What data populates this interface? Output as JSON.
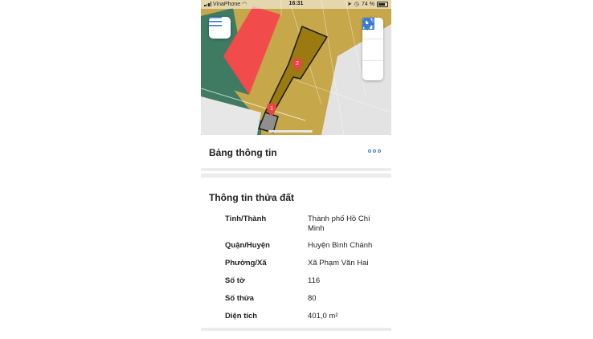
{
  "status_bar": {
    "carrier": "VinaPhone",
    "time": "16:31",
    "battery": "74 %"
  },
  "map": {
    "parcel_markers": [
      "1",
      "2"
    ],
    "colors": {
      "base_land": "#c6a74a",
      "highlight_red": "#f24b4b",
      "dark_green": "#3f7a63",
      "selected_parcel": "#9c7a12",
      "marker": "#e84545"
    },
    "buttons": {
      "menu_icon": "hamburger-menu-icon",
      "layers_icon": "grid-layers-icon",
      "location_icon": "location-pin-icon",
      "filter_icon": "sliders-icon"
    }
  },
  "panel": {
    "title": "Bảng thông tin",
    "more_icon": "more-dots-icon",
    "section_title": "Thông tin thửa đất",
    "rows": [
      {
        "label": "Tỉnh/Thành",
        "value": "Thành phố Hồ Chí Minh"
      },
      {
        "label": "Quận/Huyện",
        "value": "Huyện Bình Chánh"
      },
      {
        "label": "Phường/Xã",
        "value": "Xã Phạm Văn Hai"
      },
      {
        "label": "Số tờ",
        "value": "116"
      },
      {
        "label": "Số thửa",
        "value": "80"
      },
      {
        "label": "Diện tích",
        "value": "401,0 m²"
      }
    ]
  }
}
